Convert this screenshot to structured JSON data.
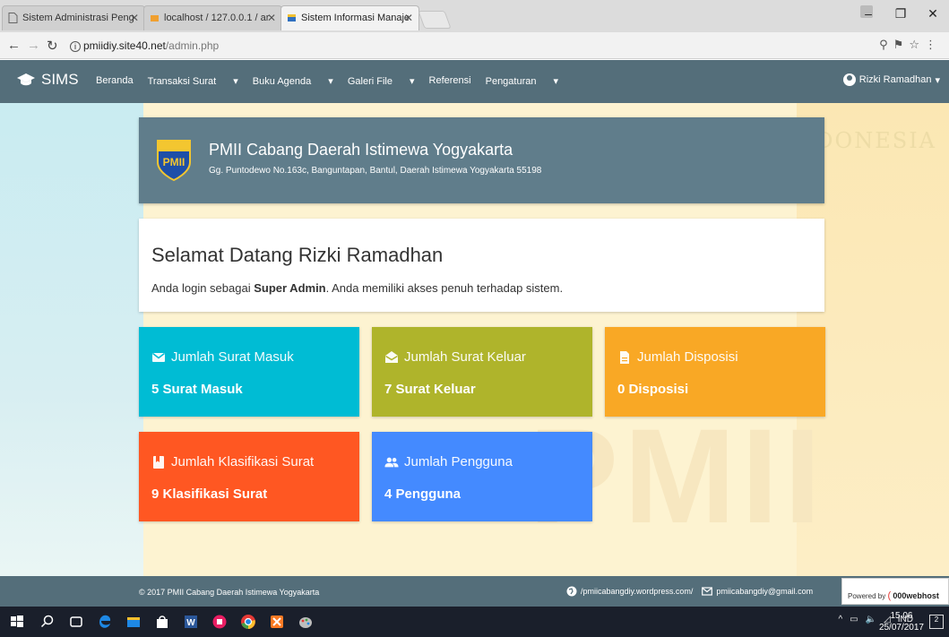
{
  "browser": {
    "tabs": [
      {
        "title": "Sistem Administrasi Peng"
      },
      {
        "title": "localhost / 127.0.0.1 / ar"
      },
      {
        "title": "Sistem Informasi Manaje"
      }
    ],
    "url_host": "pmiidiy.site40.net",
    "url_path": "/admin.php"
  },
  "navbar": {
    "brand": "SIMS",
    "items": [
      "Beranda",
      "Transaksi Surat",
      "Buku Agenda",
      "Galeri File",
      "Referensi",
      "Pengaturan"
    ],
    "user": "Rizki Ramadhan"
  },
  "header": {
    "org_name": "PMII Cabang Daerah Istimewa Yogyakarta",
    "address": "Gg. Puntodewo No.163c, Banguntapan, Bantul, Daerah Istimewa Yogyakarta 55198",
    "logo_text": "PMII"
  },
  "background": {
    "watermark_word": "INDONESIA",
    "watermark_big": "PMII"
  },
  "welcome": {
    "title": "Selamat Datang Rizki Ramadhan",
    "text_before": "Anda login sebagai ",
    "role": "Super Admin",
    "text_after": ". Anda memiliki akses penuh terhadap sistem."
  },
  "stats": [
    {
      "title": "Jumlah Surat Masuk",
      "value": "5 Surat Masuk",
      "color": "#00bcd4",
      "icon": "mail-icon"
    },
    {
      "title": "Jumlah Surat Keluar",
      "value": "7 Surat Keluar",
      "color": "#afb42b",
      "icon": "open-mail-icon"
    },
    {
      "title": "Jumlah Disposisi",
      "value": "0 Disposisi",
      "color": "#f9a825",
      "icon": "document-icon"
    },
    {
      "title": "Jumlah Klasifikasi Surat",
      "value": "9 Klasifikasi Surat",
      "color": "#ff5722",
      "icon": "bookmark-icon"
    },
    {
      "title": "Jumlah Pengguna",
      "value": "4 Pengguna",
      "color": "#448aff",
      "icon": "users-icon"
    }
  ],
  "footer": {
    "copyright": "© 2017 PMII Cabang Daerah Istimewa Yogyakarta",
    "website": "/pmiicabangdiy.wordpress.com/",
    "email": "pmiicabangdiy@gmail.com",
    "powered_by": "Powered by",
    "powered_brand": "000webhost"
  },
  "taskbar": {
    "language": "IND",
    "time": "15.06",
    "date": "25/07/2017",
    "notifications": "2"
  }
}
